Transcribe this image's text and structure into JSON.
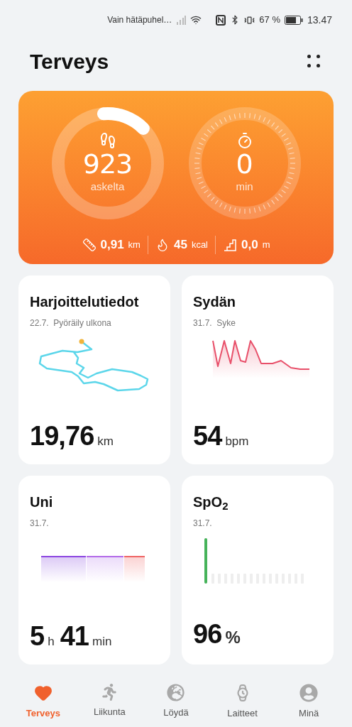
{
  "status_bar": {
    "carrier": "Vain hätäpuhel…",
    "battery": "67 %",
    "time": "13.47"
  },
  "header": {
    "title": "Terveys"
  },
  "activity": {
    "steps": {
      "value": "923",
      "unit": "askelta",
      "level": 0.14
    },
    "minutes": {
      "value": "0",
      "unit": "min"
    },
    "metrics": [
      {
        "kind": "distance",
        "value": "0,91",
        "unit": "km"
      },
      {
        "kind": "calories",
        "value": "45",
        "unit": "kcal"
      },
      {
        "kind": "climb",
        "value": "0,0",
        "unit": "m"
      }
    ]
  },
  "tiles": [
    {
      "kind": "route",
      "title": "Harjoittelutiedot",
      "subtitle": "22.7.  Pyöräily ulkona",
      "parts": [
        {
          "value": "19,76",
          "unit": "km"
        }
      ]
    },
    {
      "kind": "heart",
      "title": "Sydän",
      "subtitle": "31.7.  Syke",
      "parts": [
        {
          "value": "54",
          "unit": "bpm"
        }
      ]
    },
    {
      "kind": "sleep",
      "title": "Uni",
      "subtitle": "31.7.",
      "parts": [
        {
          "value": "5",
          "unit": "h"
        },
        {
          "value": "41",
          "unit": "min"
        }
      ]
    },
    {
      "kind": "spo2",
      "title": "SpO$_{2}$",
      "subtitle": "31.7.",
      "parts": [
        {
          "value": "96",
          "unit": "%"
        }
      ]
    }
  ],
  "nav": [
    {
      "kind": "health",
      "label": "Terveys",
      "selected": true
    },
    {
      "kind": "exercise",
      "label": "Liikunta",
      "selected": false
    },
    {
      "kind": "discover",
      "label": "Löydä",
      "selected": false
    },
    {
      "kind": "devices",
      "label": "Laitteet",
      "selected": false
    },
    {
      "kind": "me",
      "label": "Minä",
      "selected": false
    }
  ]
}
